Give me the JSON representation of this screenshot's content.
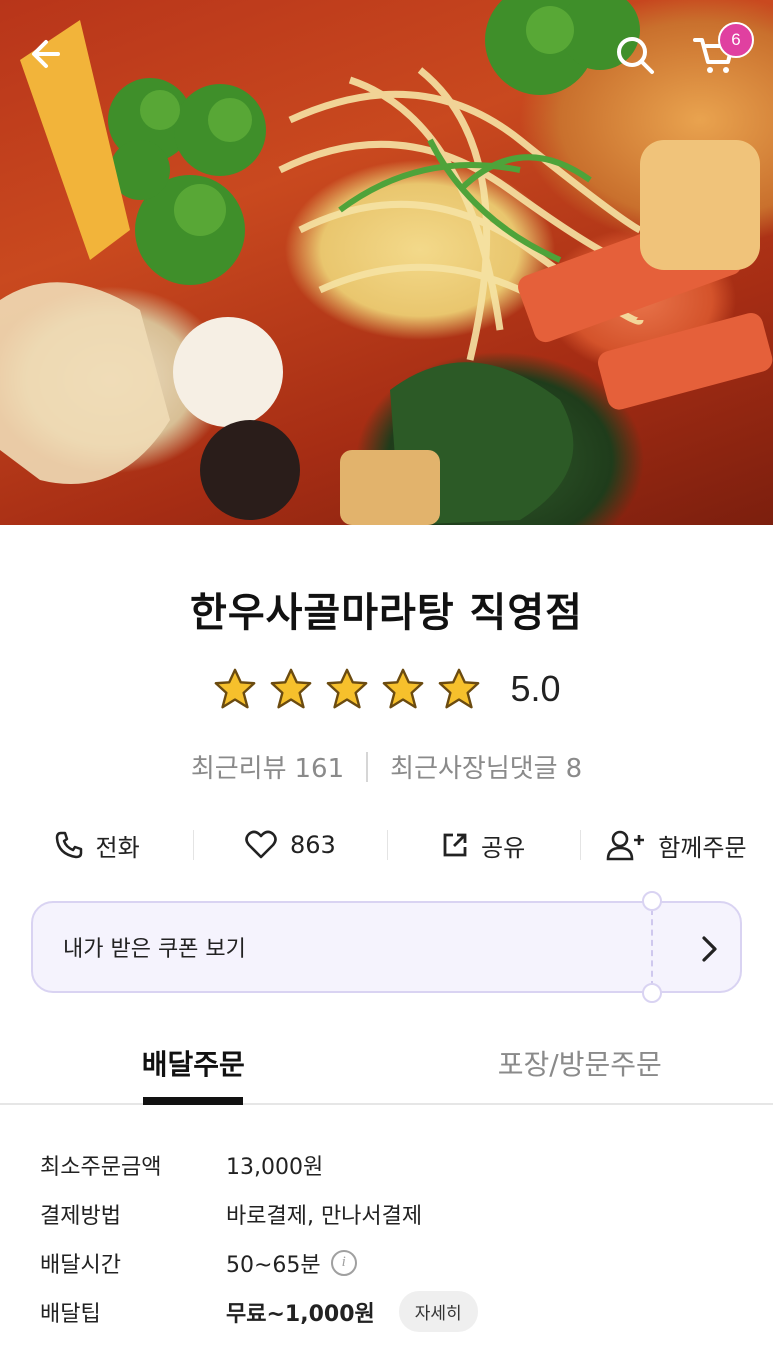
{
  "header": {
    "back_icon": "arrow-left-icon",
    "search_icon": "search-icon",
    "cart_icon": "cart-icon",
    "cart_count": "6"
  },
  "store": {
    "name": "한우사골마라탕 직영점",
    "rating": 5.0,
    "rating_text": "5.0",
    "stars": 5,
    "star_color": "#f6c02c",
    "recent_reviews_label": "최근리뷰",
    "recent_reviews_count": "161",
    "owner_replies_label": "최근사장님댓글",
    "owner_replies_count": "8"
  },
  "actions": {
    "call_label": "전화",
    "like_count": "863",
    "share_label": "공유",
    "group_order_label": "함께주문"
  },
  "coupon": {
    "label": "내가 받은 쿠폰 보기",
    "arrow_icon": "chevron-right-icon",
    "background": "#f5f3fd",
    "border": "#d9d3f2"
  },
  "tabs": [
    {
      "label": "배달주문",
      "active": true
    },
    {
      "label": "포장/방문주문",
      "active": false
    }
  ],
  "info": {
    "min_order_label": "최소주문금액",
    "min_order_value": "13,000원",
    "payment_label": "결제방법",
    "payment_value": "바로결제, 만나서결제",
    "delivery_time_label": "배달시간",
    "delivery_time_value": "50~65분",
    "delivery_tip_label": "배달팁",
    "delivery_tip_value": "무료~1,000원",
    "detail_button": "자세히"
  },
  "colors": {
    "badge": "#e040a0",
    "accent_text": "#111111",
    "muted_text": "#8a8a8a"
  }
}
